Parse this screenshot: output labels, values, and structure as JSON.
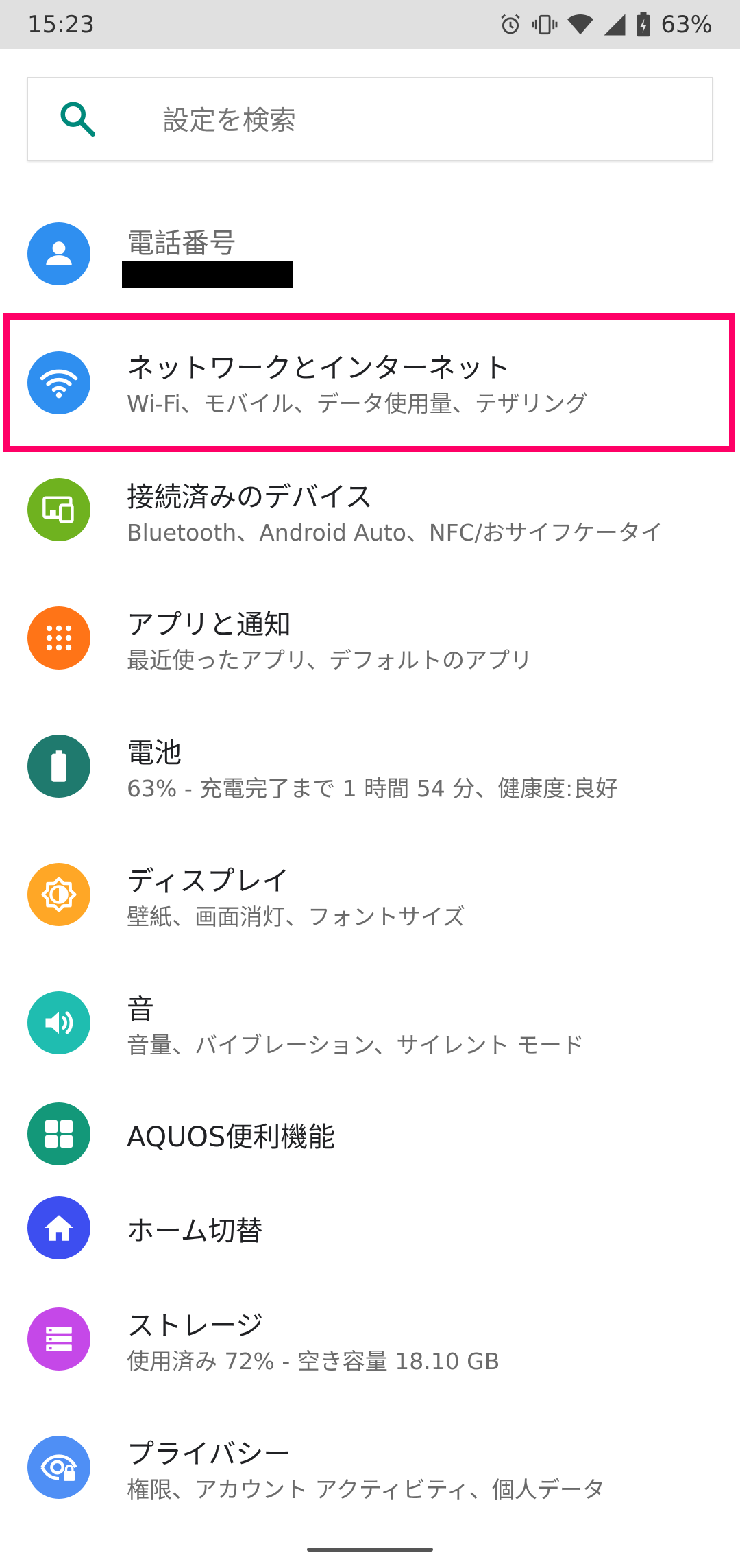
{
  "status_bar": {
    "time": "15:23",
    "battery_percent": "63%",
    "icons": [
      "alarm-icon",
      "vibrate-icon",
      "wifi-icon",
      "signal-icon",
      "battery-charging-icon"
    ]
  },
  "search": {
    "placeholder": "設定を検索",
    "icon": "search-icon",
    "accent": "#00897b"
  },
  "account": {
    "title": "電話番号",
    "value_redacted": true,
    "icon": "person-icon",
    "color": "#2f8ff0"
  },
  "settings": [
    {
      "id": "network",
      "title": "ネットワークとインターネット",
      "subtitle": "Wi-Fi、モバイル、データ使用量、テザリング",
      "icon": "wifi-icon",
      "color": "#2f8ff0",
      "highlighted": true
    },
    {
      "id": "connected-devices",
      "title": "接続済みのデバイス",
      "subtitle": "Bluetooth、Android Auto、NFC/おサイフケータイ",
      "icon": "devices-icon",
      "color": "#6fb21f"
    },
    {
      "id": "apps",
      "title": "アプリと通知",
      "subtitle": "最近使ったアプリ、デフォルトのアプリ",
      "icon": "apps-grid-icon",
      "color": "#ff7417"
    },
    {
      "id": "battery",
      "title": "電池",
      "subtitle": "63% - 充電完了まで 1 時間 54 分、健康度:良好",
      "icon": "battery-icon",
      "color": "#1f7a6e"
    },
    {
      "id": "display",
      "title": "ディスプレイ",
      "subtitle": "壁紙、画面消灯、フォントサイズ",
      "icon": "brightness-icon",
      "color": "#ffa726"
    },
    {
      "id": "sound",
      "title": "音",
      "subtitle": "音量、バイブレーション、サイレント モード",
      "icon": "volume-icon",
      "color": "#1fbdb0"
    },
    {
      "id": "aquos",
      "title": "AQUOS便利機能",
      "subtitle": "",
      "icon": "grid-tiles-icon",
      "color": "#139879"
    },
    {
      "id": "home-switch",
      "title": "ホーム切替",
      "subtitle": "",
      "icon": "home-icon",
      "color": "#3d4ef0"
    },
    {
      "id": "storage",
      "title": "ストレージ",
      "subtitle": "使用済み 72% - 空き容量 18.10 GB",
      "icon": "storage-icon",
      "color": "#c548e8"
    },
    {
      "id": "privacy",
      "title": "プライバシー",
      "subtitle": "権限、アカウント アクティビティ、個人データ",
      "icon": "privacy-eye-icon",
      "color": "#4f8ff5"
    }
  ]
}
